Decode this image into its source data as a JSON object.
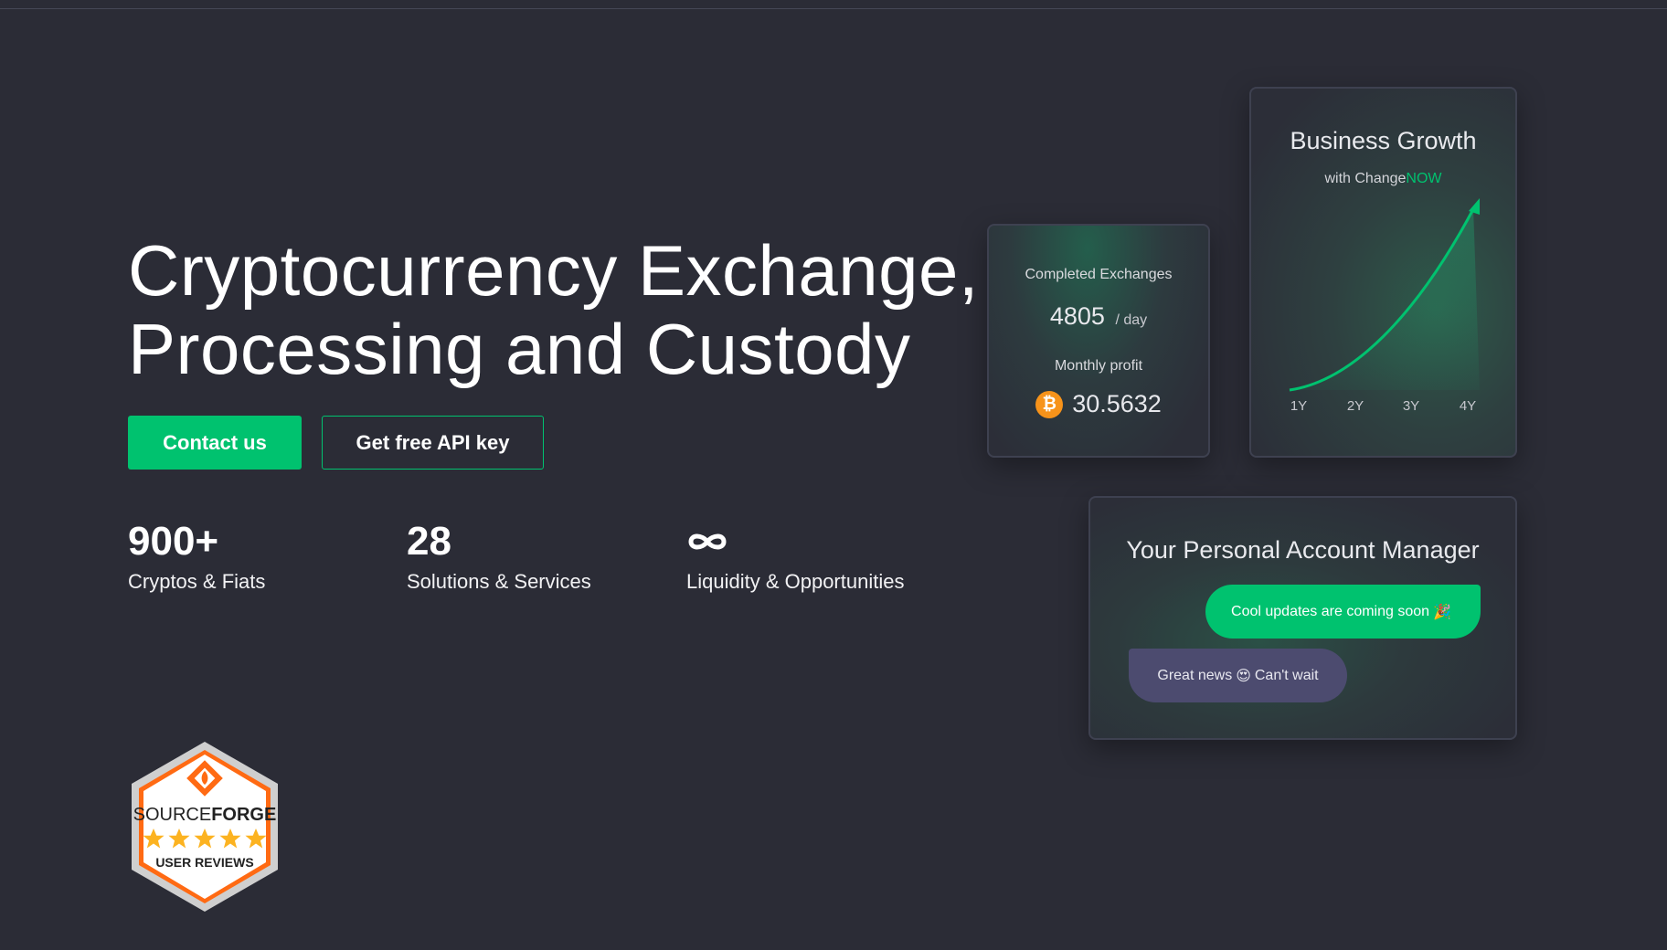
{
  "hero": {
    "title_line1": "Cryptocurrency Exchange,",
    "title_line2": "Processing and Custody"
  },
  "buttons": {
    "contact": "Contact us",
    "api_key": "Get free API key"
  },
  "stats": [
    {
      "value": "900+",
      "label": "Cryptos & Fiats"
    },
    {
      "value": "28",
      "label": "Solutions & Services"
    },
    {
      "value": "∞",
      "label": "Liquidity & Opportunities",
      "icon": "infinity-icon"
    }
  ],
  "exchanges_card": {
    "label": "Completed Exchanges",
    "value": "4805",
    "unit": "/ day",
    "profit_label": "Monthly profit",
    "profit_value": "30.5632",
    "currency_icon": "bitcoin-icon"
  },
  "growth_card": {
    "title": "Business Growth",
    "subtitle_prefix": "with Change",
    "subtitle_brand": "NOW",
    "x_labels": [
      "1Y",
      "2Y",
      "3Y",
      "4Y"
    ]
  },
  "manager_card": {
    "title": "Your Personal Account Manager",
    "message_1": "Cool updates are coming soon",
    "message_1_emoji": "🎉",
    "message_2_part1": "Great news",
    "message_2_emoji": "😍",
    "message_2_part2": "Can't wait"
  },
  "badge": {
    "brand_a": "SOURCE",
    "brand_b": "FORGE",
    "caption": "USER REVIEWS",
    "rating_stars": 5
  },
  "colors": {
    "accent": "#00c26f",
    "background": "#2b2c36",
    "bubble_purple": "#4c4b6f",
    "bitcoin": "#f7931a",
    "badge_orange": "#ff6a13"
  }
}
